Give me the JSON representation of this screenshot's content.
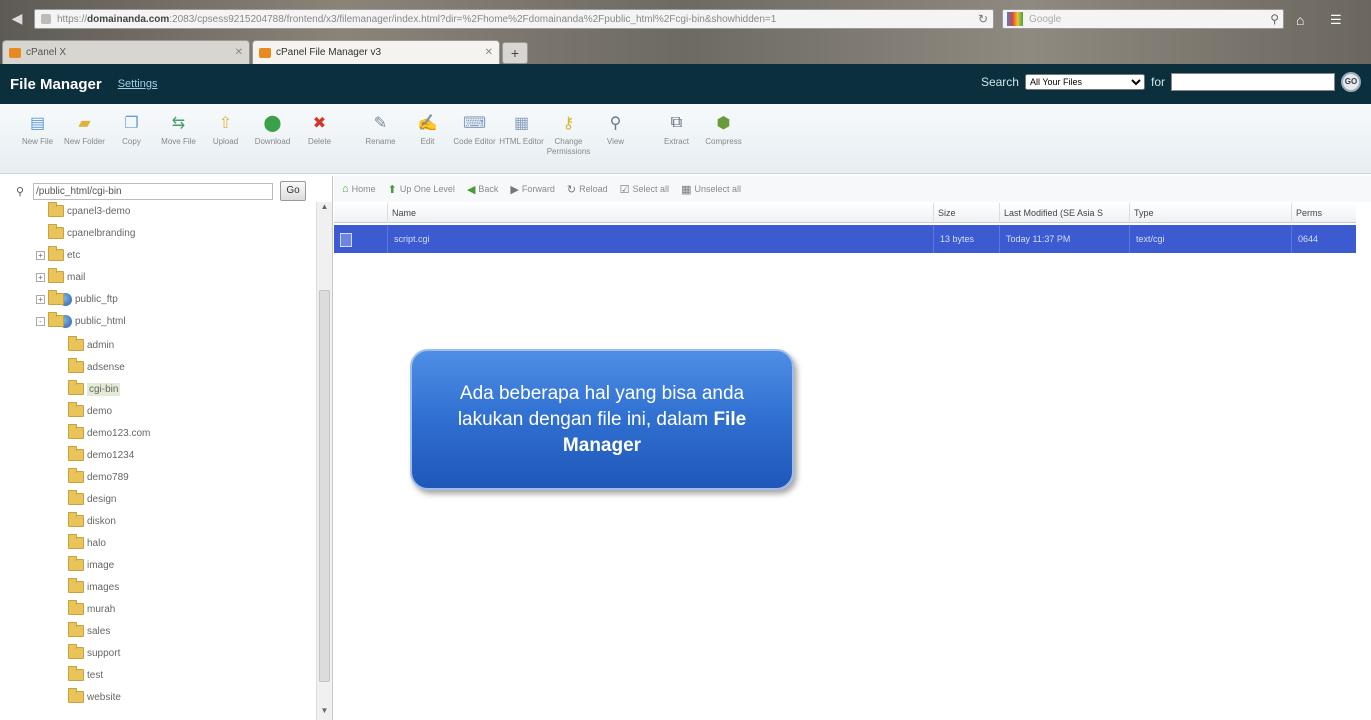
{
  "browser": {
    "url_pre": "https://",
    "url_host": "domainanda.com",
    "url_rest": ":2083/cpsess9215204788/frontend/x3/filemanager/index.html?dir=%2Fhome%2Fdomainanda%2Fpublic_html%2Fcgi-bin&showhidden=1",
    "search_placeholder": "Google",
    "tabs": [
      {
        "label": "cPanel X",
        "active": false
      },
      {
        "label": "cPanel File Manager v3",
        "active": true
      }
    ],
    "new_tab_label": "+"
  },
  "header": {
    "title": "File Manager",
    "settings_label": "Settings",
    "search_label": "Search",
    "search_scope": "All Your Files",
    "for_label": "for",
    "go_label": "GO"
  },
  "toolbar": [
    {
      "label": "New File",
      "icon": "new-file-icon",
      "color": "#5a9ad6"
    },
    {
      "label": "New Folder",
      "icon": "new-folder-icon",
      "color": "#e0b23a"
    },
    {
      "label": "Copy",
      "icon": "copy-icon",
      "color": "#6aa0d8"
    },
    {
      "label": "Move File",
      "icon": "move-file-icon",
      "color": "#4c9c6a"
    },
    {
      "label": "Upload",
      "icon": "upload-icon",
      "color": "#e0b23a"
    },
    {
      "label": "Download",
      "icon": "download-icon",
      "color": "#3aa04a"
    },
    {
      "label": "Delete",
      "icon": "delete-icon",
      "color": "#d8332a"
    },
    {
      "label": "Rename",
      "icon": "rename-icon",
      "color": "#7a8a9a"
    },
    {
      "label": "Edit",
      "icon": "edit-icon",
      "color": "#7a8a9a"
    },
    {
      "label": "Code Editor",
      "icon": "code-editor-icon",
      "color": "#8aa0c0"
    },
    {
      "label": "HTML Editor",
      "icon": "html-editor-icon",
      "color": "#8aa0c0"
    },
    {
      "label": "Change Permissions",
      "icon": "key-icon",
      "color": "#d9b53a"
    },
    {
      "label": "View",
      "icon": "view-icon",
      "color": "#6a7a8a"
    },
    {
      "label": "Extract",
      "icon": "extract-icon",
      "color": "#556070"
    },
    {
      "label": "Compress",
      "icon": "compress-icon",
      "color": "#6a9a3a"
    }
  ],
  "tree": {
    "path": "/public_html/cgi-bin",
    "go_label": "Go",
    "items": [
      {
        "label": "cpanel3-demo",
        "level": 1,
        "expand": ""
      },
      {
        "label": "cpanelbranding",
        "level": 1,
        "expand": ""
      },
      {
        "label": "etc",
        "level": 0,
        "expand": "+"
      },
      {
        "label": "mail",
        "level": 0,
        "expand": "+"
      },
      {
        "label": "public_ftp",
        "level": 0,
        "expand": "+"
      },
      {
        "label": "public_html",
        "level": 0,
        "expand": "-"
      },
      {
        "label": "admin",
        "level": 2,
        "expand": ""
      },
      {
        "label": "adsense",
        "level": 2,
        "expand": ""
      },
      {
        "label": "cgi-bin",
        "level": 2,
        "expand": "",
        "selected": true
      },
      {
        "label": "demo",
        "level": 2,
        "expand": ""
      },
      {
        "label": "demo123.com",
        "level": 2,
        "expand": ""
      },
      {
        "label": "demo1234",
        "level": 2,
        "expand": ""
      },
      {
        "label": "demo789",
        "level": 2,
        "expand": ""
      },
      {
        "label": "design",
        "level": 2,
        "expand": ""
      },
      {
        "label": "diskon",
        "level": 2,
        "expand": ""
      },
      {
        "label": "halo",
        "level": 2,
        "expand": ""
      },
      {
        "label": "image",
        "level": 2,
        "expand": ""
      },
      {
        "label": "images",
        "level": 2,
        "expand": ""
      },
      {
        "label": "murah",
        "level": 2,
        "expand": ""
      },
      {
        "label": "sales",
        "level": 2,
        "expand": ""
      },
      {
        "label": "support",
        "level": 2,
        "expand": ""
      },
      {
        "label": "test",
        "level": 2,
        "expand": ""
      },
      {
        "label": "website",
        "level": 2,
        "expand": ""
      }
    ]
  },
  "nav": [
    {
      "label": "Home",
      "icon": "home-icon"
    },
    {
      "label": "Up One Level",
      "icon": "up-level-icon"
    },
    {
      "label": "Back",
      "icon": "back-icon"
    },
    {
      "label": "Forward",
      "icon": "forward-icon"
    },
    {
      "label": "Reload",
      "icon": "reload-icon"
    },
    {
      "label": "Select all",
      "icon": "select-all-icon"
    },
    {
      "label": "Unselect all",
      "icon": "unselect-all-icon"
    }
  ],
  "table": {
    "headers": {
      "name": "Name",
      "size": "Size",
      "modified": "Last Modified (SE Asia S",
      "type": "Type",
      "perms": "Perms"
    },
    "rows": [
      {
        "name": "script.cgi",
        "size": "13 bytes",
        "modified": "Today 11:37 PM",
        "type": "text/cgi",
        "perms": "0644"
      }
    ]
  },
  "callout": {
    "text": "Ada beberapa hal yang bisa anda lakukan dengan file ini, dalam",
    "bold": "File Manager"
  },
  "colors": {
    "header_bg": "#0c2f3e",
    "row_selected": "#3d5bd1",
    "callout": "#2f6fd0"
  }
}
